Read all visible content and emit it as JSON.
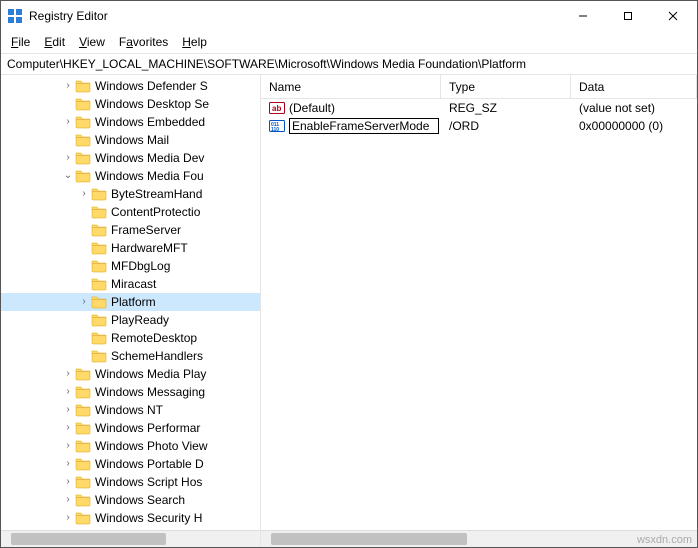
{
  "titlebar": {
    "title": "Registry Editor"
  },
  "menu": {
    "file_u": "F",
    "file_r": "ile",
    "edit_u": "E",
    "edit_r": "dit",
    "view_u": "V",
    "view_r": "iew",
    "fav_l": "F",
    "fav_u": "a",
    "fav_r": "vorites",
    "help_u": "H",
    "help_r": "elp"
  },
  "address": {
    "path": "Computer\\HKEY_LOCAL_MACHINE\\SOFTWARE\\Microsoft\\Windows Media Foundation\\Platform"
  },
  "tree": [
    {
      "depth": 2,
      "tw": ">",
      "label": "Windows Defender S"
    },
    {
      "depth": 2,
      "tw": "",
      "label": "Windows Desktop Se"
    },
    {
      "depth": 2,
      "tw": ">",
      "label": "Windows Embedded"
    },
    {
      "depth": 2,
      "tw": "",
      "label": "Windows Mail"
    },
    {
      "depth": 2,
      "tw": ">",
      "label": "Windows Media Dev"
    },
    {
      "depth": 2,
      "tw": "v",
      "label": "Windows Media Fou"
    },
    {
      "depth": 3,
      "tw": ">",
      "label": "ByteStreamHand"
    },
    {
      "depth": 3,
      "tw": "",
      "label": "ContentProtectio"
    },
    {
      "depth": 3,
      "tw": "",
      "label": "FrameServer"
    },
    {
      "depth": 3,
      "tw": "",
      "label": "HardwareMFT"
    },
    {
      "depth": 3,
      "tw": "",
      "label": "MFDbgLog"
    },
    {
      "depth": 3,
      "tw": "",
      "label": "Miracast"
    },
    {
      "depth": 3,
      "tw": ">",
      "label": "Platform",
      "selected": true
    },
    {
      "depth": 3,
      "tw": "",
      "label": "PlayReady"
    },
    {
      "depth": 3,
      "tw": "",
      "label": "RemoteDesktop"
    },
    {
      "depth": 3,
      "tw": "",
      "label": "SchemeHandlers"
    },
    {
      "depth": 2,
      "tw": ">",
      "label": "Windows Media Play"
    },
    {
      "depth": 2,
      "tw": ">",
      "label": "Windows Messaging"
    },
    {
      "depth": 2,
      "tw": ">",
      "label": "Windows NT"
    },
    {
      "depth": 2,
      "tw": ">",
      "label": "Windows Performar"
    },
    {
      "depth": 2,
      "tw": ">",
      "label": "Windows Photo View"
    },
    {
      "depth": 2,
      "tw": ">",
      "label": "Windows Portable D"
    },
    {
      "depth": 2,
      "tw": ">",
      "label": "Windows Script Hos"
    },
    {
      "depth": 2,
      "tw": ">",
      "label": "Windows Search"
    },
    {
      "depth": 2,
      "tw": ">",
      "label": "Windows Security H"
    }
  ],
  "list": {
    "columns": {
      "name": "Name",
      "type": "Type",
      "data": "Data"
    },
    "rows": [
      {
        "icon": "sz",
        "name": "(Default)",
        "type": "REG_SZ",
        "data": "(value not set)",
        "editing": false
      },
      {
        "icon": "dword",
        "name": "EnableFrameServerMode",
        "type_suffix": "/ORD",
        "data": "0x00000000 (0)",
        "editing": true
      }
    ]
  },
  "watermark": "wsxdn.com"
}
